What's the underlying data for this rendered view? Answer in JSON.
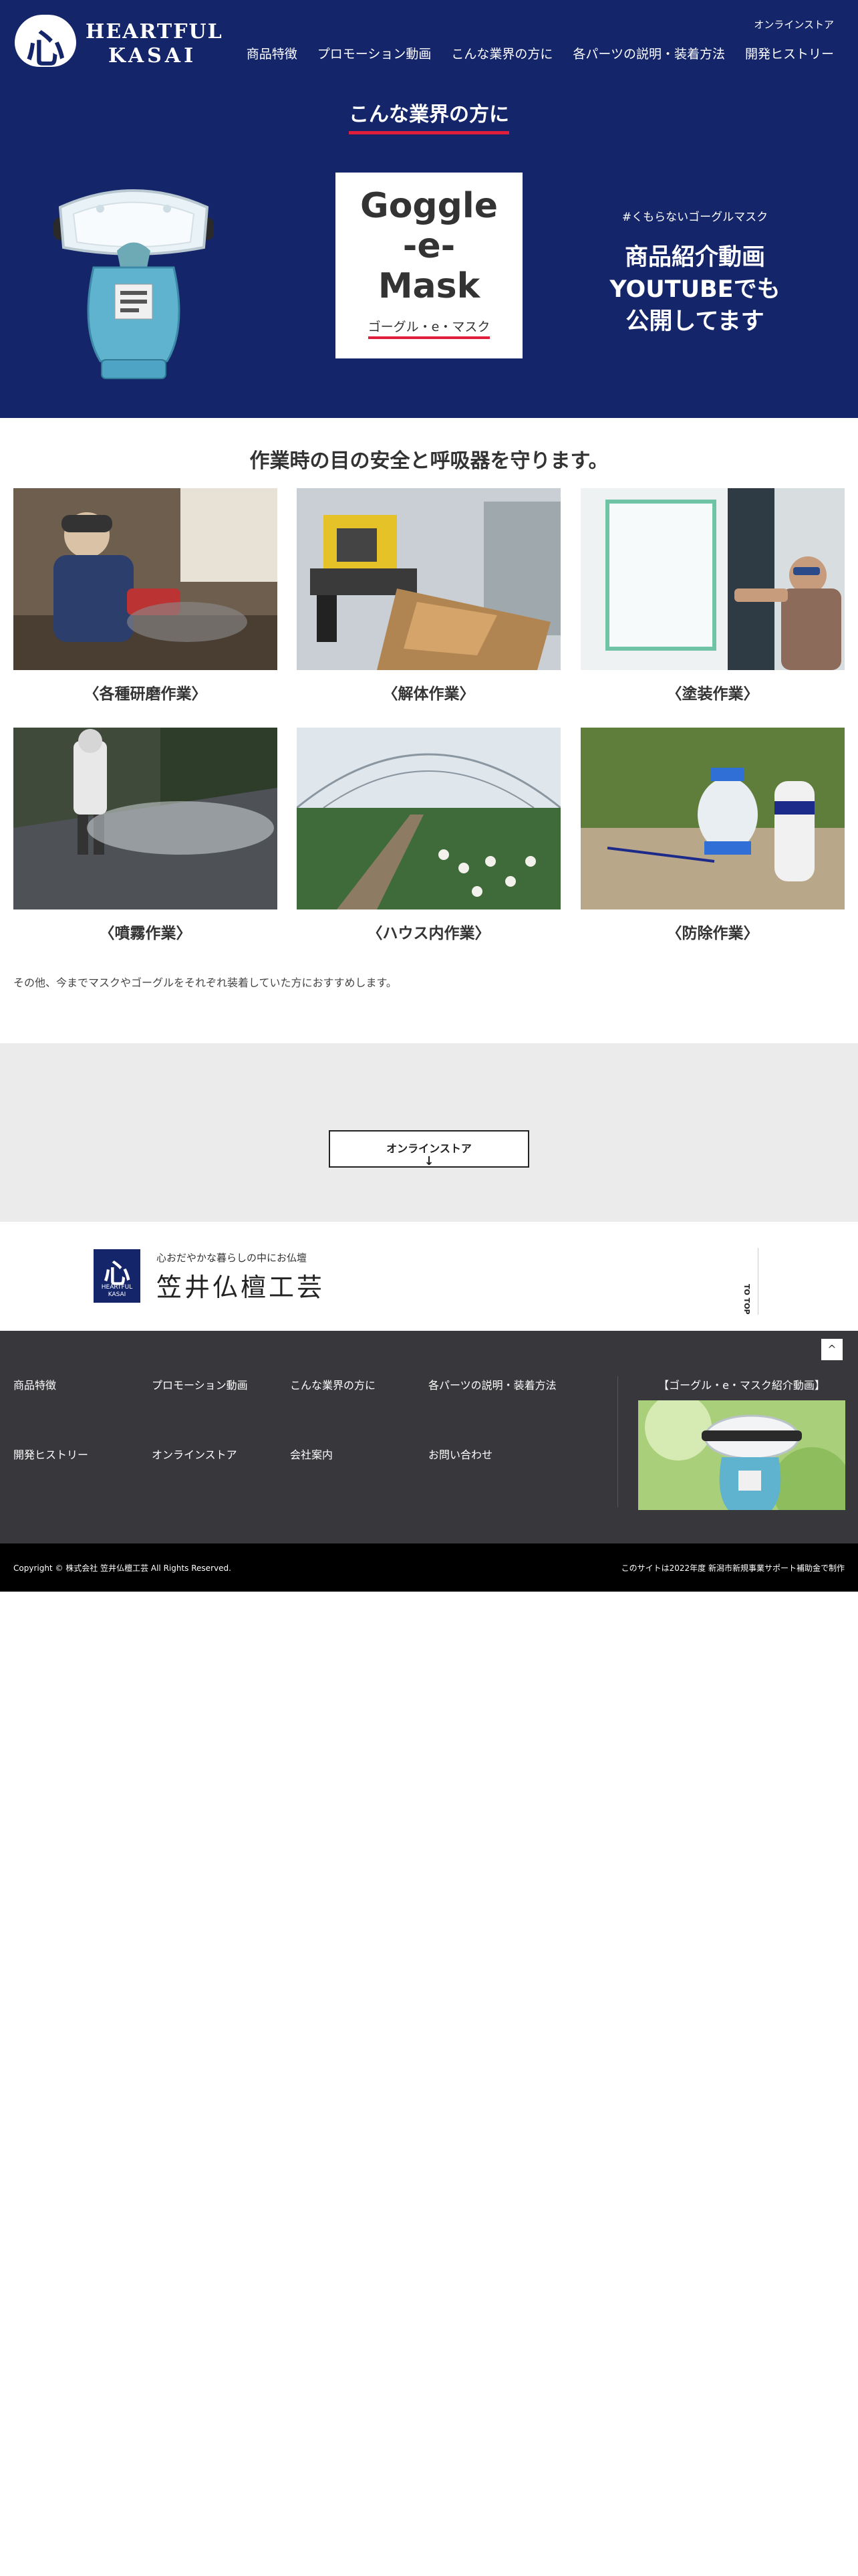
{
  "header": {
    "logo_line1": "HEARTFUL",
    "logo_line2": "KASAI",
    "logo_glyph": "心",
    "top_link": "オンラインストア",
    "nav": [
      "商品特徴",
      "プロモーション動画",
      "こんな業界の方に",
      "各パーツの説明・装着方法",
      "開発ヒストリー"
    ]
  },
  "hero": {
    "heading": "こんな業界の方に",
    "card_title": "Goggle\n-e-\nMask",
    "card_subtitle": "ゴーグル・e・マスク",
    "promo_tag": "#くもらないゴーグルマスク",
    "promo_text": "商品紹介動画\nYOUTUBEでも\n公開してます"
  },
  "work": {
    "title": "作業時の目の安全と呼吸器を守ります。",
    "items": [
      {
        "label": "〈各種研磨作業〉",
        "icon": "grinding-photo"
      },
      {
        "label": "〈解体作業〉",
        "icon": "demolition-photo"
      },
      {
        "label": "〈塗装作業〉",
        "icon": "painting-photo"
      },
      {
        "label": "〈噴霧作業〉",
        "icon": "spraying-photo"
      },
      {
        "label": "〈ハウス内作業〉",
        "icon": "greenhouse-photo"
      },
      {
        "label": "〈防除作業〉",
        "icon": "pest-control-photo"
      }
    ],
    "note": "その他、今までマスクやゴーグルをそれぞれ装着していた方におすすめします。"
  },
  "store": {
    "button_label": "オンラインストア",
    "arrow": "↓"
  },
  "company": {
    "mark_glyph": "心",
    "mark_text": "HEARTFUL\nKASAI",
    "tagline": "心おだやかな暮らしの中にお仏壇",
    "name": "笠井仏檀工芸",
    "to_top": "TO TOP"
  },
  "footer": {
    "top_button": "^",
    "links_row1": [
      "商品特徴",
      "プロモーション動画",
      "こんな業界の方に",
      "各パーツの説明・装着方法"
    ],
    "links_row2": [
      "開発ヒストリー",
      "オンラインストア",
      "会社案内",
      "お問い合わせ"
    ],
    "video_title": "【ゴーグル・e・マスク紹介動画】",
    "copyright": "Copyright © 株式会社 笠井仏檀工芸 All Rights Reserved.",
    "credit": "このサイトは2022年度 新潟市新規事業サポート補助金で制作"
  },
  "colors": {
    "navy": "#14256a",
    "accent_red": "#e01e3c",
    "footer_gray": "#38383c",
    "band_gray": "#ebebeb"
  }
}
